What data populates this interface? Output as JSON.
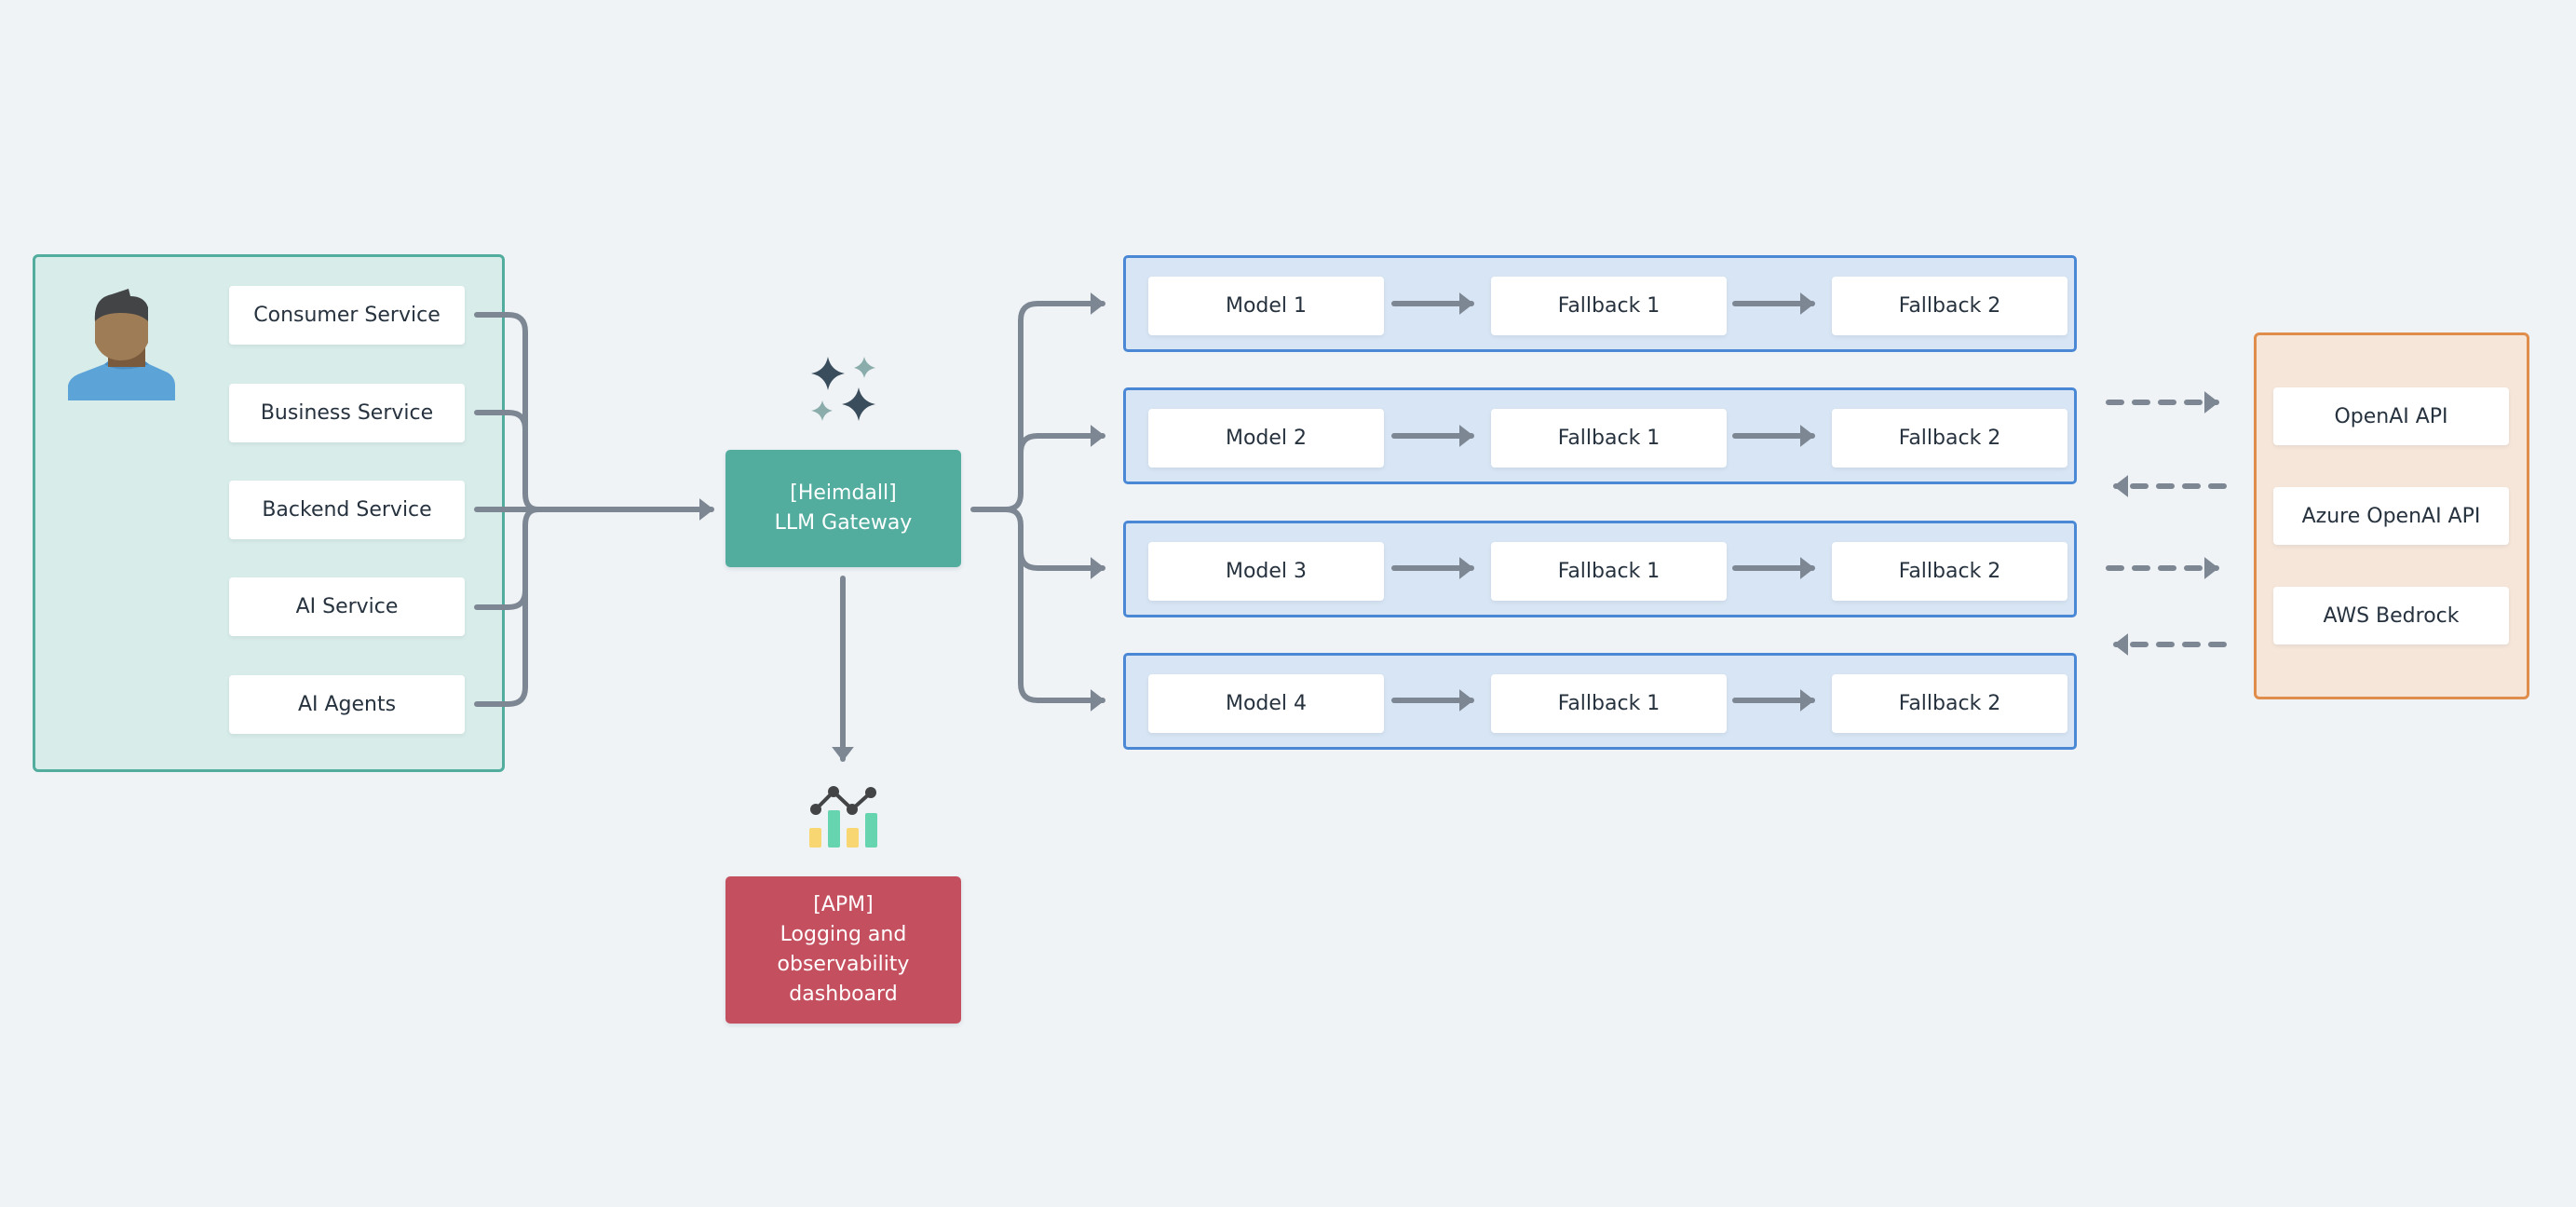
{
  "clients": {
    "services": [
      {
        "label": "Consumer Service"
      },
      {
        "label": "Business Service"
      },
      {
        "label": "Backend Service"
      },
      {
        "label": "AI Service"
      },
      {
        "label": "AI Agents"
      }
    ]
  },
  "gateway": {
    "line1": "[Heimdall]",
    "line2": "LLM Gateway"
  },
  "apm": {
    "line1": "[APM]",
    "line2": "Logging and",
    "line3": "observability",
    "line4": "dashboard"
  },
  "model_rows": [
    {
      "model": "Model 1",
      "fallback1": "Fallback 1",
      "fallback2": "Fallback 2"
    },
    {
      "model": "Model 2",
      "fallback1": "Fallback 1",
      "fallback2": "Fallback 2"
    },
    {
      "model": "Model 3",
      "fallback1": "Fallback 1",
      "fallback2": "Fallback 2"
    },
    {
      "model": "Model 4",
      "fallback1": "Fallback 1",
      "fallback2": "Fallback 2"
    }
  ],
  "providers": [
    {
      "label": "OpenAI API"
    },
    {
      "label": "Azure OpenAI API"
    },
    {
      "label": "AWS Bedrock"
    }
  ],
  "colors": {
    "background": "#eff3f6",
    "clients_fill": "#d8ecea",
    "clients_border": "#52ad9f",
    "gateway": "#52ad9f",
    "apm": "#c4505f",
    "model_row_fill": "#d8e5f4",
    "model_row_border": "#4a88d6",
    "providers_fill": "#f6e6da",
    "providers_border": "#e08c4b",
    "connector": "#7d8793"
  }
}
